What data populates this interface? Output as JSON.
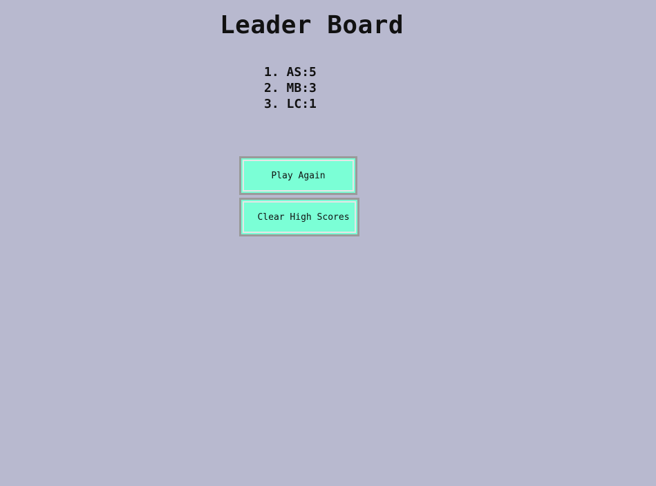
{
  "page": {
    "title": "Leader Board",
    "background_color": "#b8b9cf"
  },
  "leaderboard": {
    "entries": [
      {
        "rank": "1.",
        "text": "AS:5"
      },
      {
        "rank": "2.",
        "text": "MB:3"
      },
      {
        "rank": "3.",
        "text": "LC:1"
      }
    ]
  },
  "buttons": {
    "play_again_label": "Play Again",
    "clear_scores_label": "Clear High Scores",
    "color": "#7bffd6"
  }
}
